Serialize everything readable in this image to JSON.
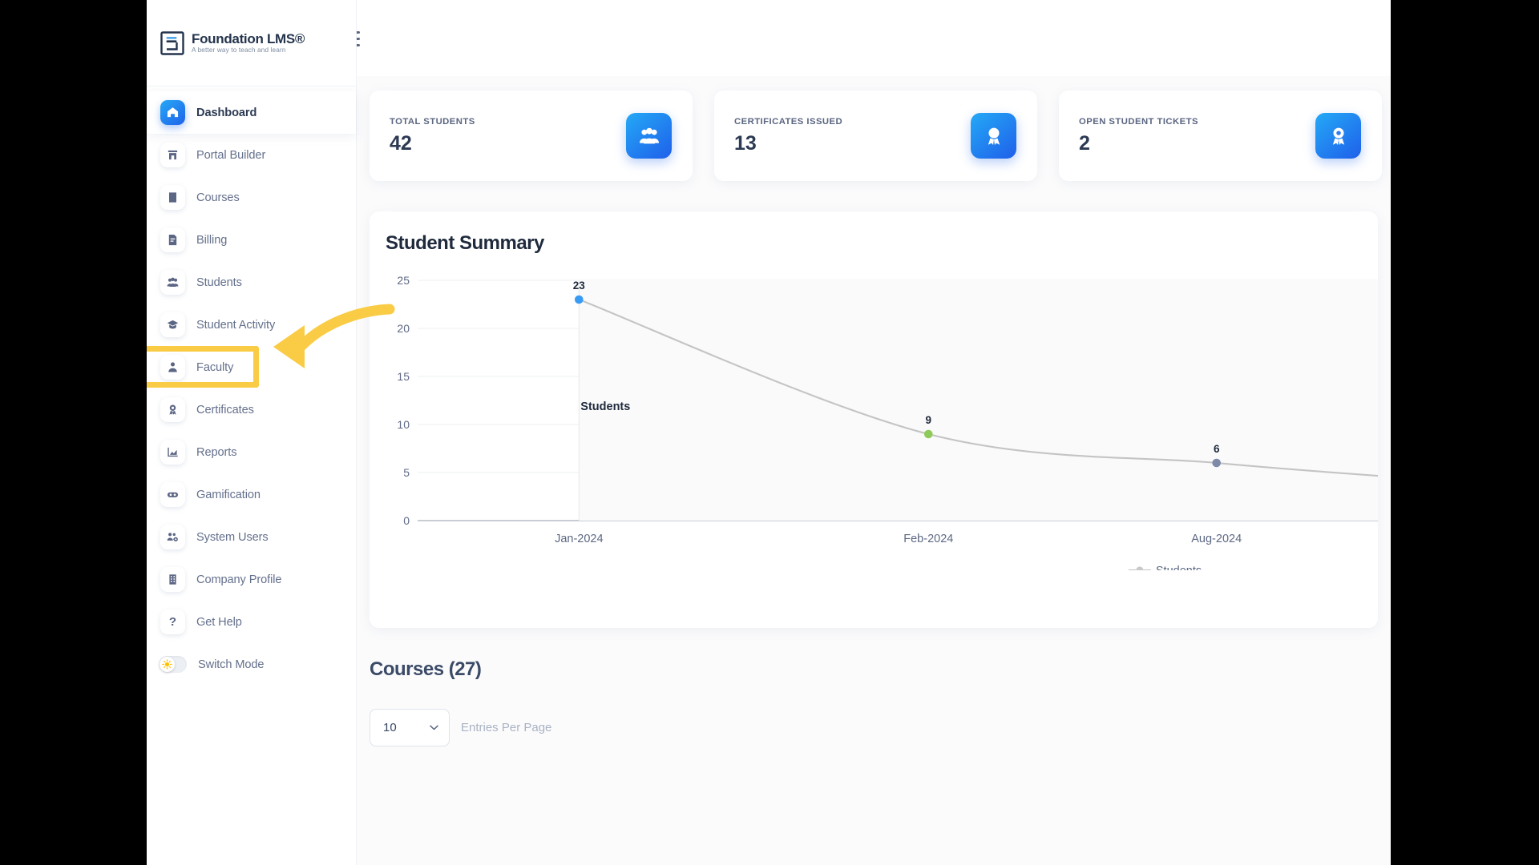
{
  "brand": {
    "title": "Foundation LMS®",
    "tagline": "A better way to teach and learn",
    "logo_icon": "document-lines-icon",
    "accent": "#1f63ea",
    "annotation_color": "#facc45"
  },
  "topbar": {
    "menu_icon": "hamburger-menu-icon"
  },
  "sidebar": {
    "items": [
      {
        "label": "Dashboard",
        "icon": "home-icon",
        "active": true
      },
      {
        "label": "Portal Builder",
        "icon": "portal-icon",
        "active": false
      },
      {
        "label": "Courses",
        "icon": "book-icon",
        "active": false
      },
      {
        "label": "Billing",
        "icon": "invoice-icon",
        "active": false
      },
      {
        "label": "Students",
        "icon": "users-group-icon",
        "active": false
      },
      {
        "label": "Student Activity",
        "icon": "graduation-cap-icon",
        "active": false
      },
      {
        "label": "Faculty",
        "icon": "user-tie-icon",
        "active": false
      },
      {
        "label": "Certificates",
        "icon": "award-icon",
        "active": false
      },
      {
        "label": "Reports",
        "icon": "chart-area-icon",
        "active": false
      },
      {
        "label": "Gamification",
        "icon": "gamepad-icon",
        "active": false
      },
      {
        "label": "System Users",
        "icon": "users-cog-icon",
        "active": false
      },
      {
        "label": "Company Profile",
        "icon": "building-icon",
        "active": false
      },
      {
        "label": "Get Help",
        "icon": "question-mark-icon",
        "active": false
      },
      {
        "label": "Switch Mode",
        "icon": "sun-toggle-icon",
        "active": false
      }
    ]
  },
  "stats": [
    {
      "label": "TOTAL STUDENTS",
      "value": "42",
      "icon": "users-group-icon"
    },
    {
      "label": "CERTIFICATES ISSUED",
      "value": "13",
      "icon": "award-icon"
    },
    {
      "label": "OPEN STUDENT TICKETS",
      "value": "2",
      "icon": "ticket-icon"
    }
  ],
  "chart_panel": {
    "title": "Student Summary"
  },
  "chart_data": {
    "type": "line",
    "title": "Student Summary",
    "xlabel": "",
    "ylabel": "",
    "categories": [
      "Jan-2024",
      "Feb-2024",
      "Aug-2024"
    ],
    "series": [
      {
        "name": "Students",
        "values": [
          23,
          9,
          6
        ],
        "point_colors": [
          "#3a9bf4",
          "#8ecb5a",
          "#7d8aa8"
        ],
        "line_color": "#c4c4c4"
      }
    ],
    "data_labels": [
      "23",
      "9",
      "6"
    ],
    "series_annotation": "Students",
    "ytick_labels": [
      "0",
      "5",
      "10",
      "15",
      "20",
      "25"
    ],
    "ylim": [
      0,
      25
    ],
    "grid": true,
    "legend": {
      "position": "bottom",
      "entries": [
        "Students"
      ]
    }
  },
  "courses": {
    "title": "Courses (27)",
    "entries_value": "10",
    "entries_label": "Entries Per Page",
    "chevron_icon": "chevron-down-icon"
  },
  "annotation": {
    "target": "Faculty",
    "box_icon": "highlight-box",
    "arrow_icon": "curved-arrow-left-icon"
  }
}
